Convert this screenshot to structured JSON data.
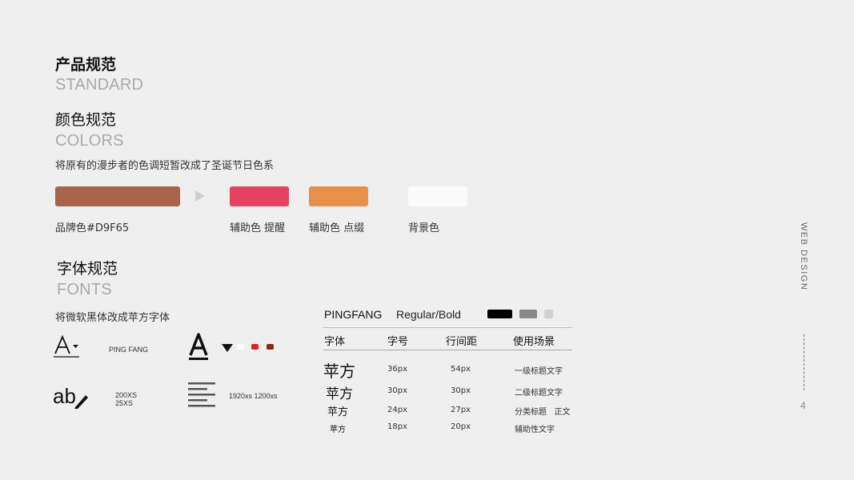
{
  "product": {
    "title_cn": "产品规范",
    "title_en": "STANDARD"
  },
  "colors": {
    "title_cn": "颜色规范",
    "title_en": "COLORS",
    "description": "将原有的漫步者的色调短暂改成了圣诞节日色系",
    "swatches": [
      {
        "label": "品牌色#D9F65",
        "color": "#a9634a"
      },
      {
        "label": "辅助色 提醒",
        "color": "#e4425e"
      },
      {
        "label": "辅助色 点缀",
        "color": "#e88f4a"
      },
      {
        "label": "背景色",
        "color": "#fafafa"
      }
    ]
  },
  "fonts": {
    "title_cn": "字体规范",
    "title_en": "FONTS",
    "description": "将微软黑体改成苹方字体",
    "icons": {
      "font_family_label": "PING FANG",
      "size_label_1": "200XS",
      "size_label_2": "25XS",
      "width_label": "1920xs  1200xs",
      "font_color_chips": [
        "#ffffff",
        "#e01e1e",
        "#8a2a12"
      ]
    },
    "spec": {
      "family": "PINGFANG",
      "weights": "Regular/Bold",
      "color_chips": [
        "#000000",
        "#888888",
        "#d0d0d0"
      ],
      "headers": [
        "字体",
        "字号",
        "行间距",
        "使用场景"
      ],
      "rows": [
        {
          "sample": "苹方",
          "size": "36px",
          "line": "54px",
          "usage": "一级标题文字"
        },
        {
          "sample": "苹方",
          "size": "30px",
          "line": "30px",
          "usage": "二级标题文字"
        },
        {
          "sample": "苹方",
          "size": "24px",
          "line": "27px",
          "usage": "分类标题   正文"
        },
        {
          "sample": "苹方",
          "size": "18px",
          "line": "20px",
          "usage": "辅助性文字"
        }
      ]
    }
  },
  "side": {
    "vertical_label": "WEB DESIGN",
    "page_number": "4"
  }
}
